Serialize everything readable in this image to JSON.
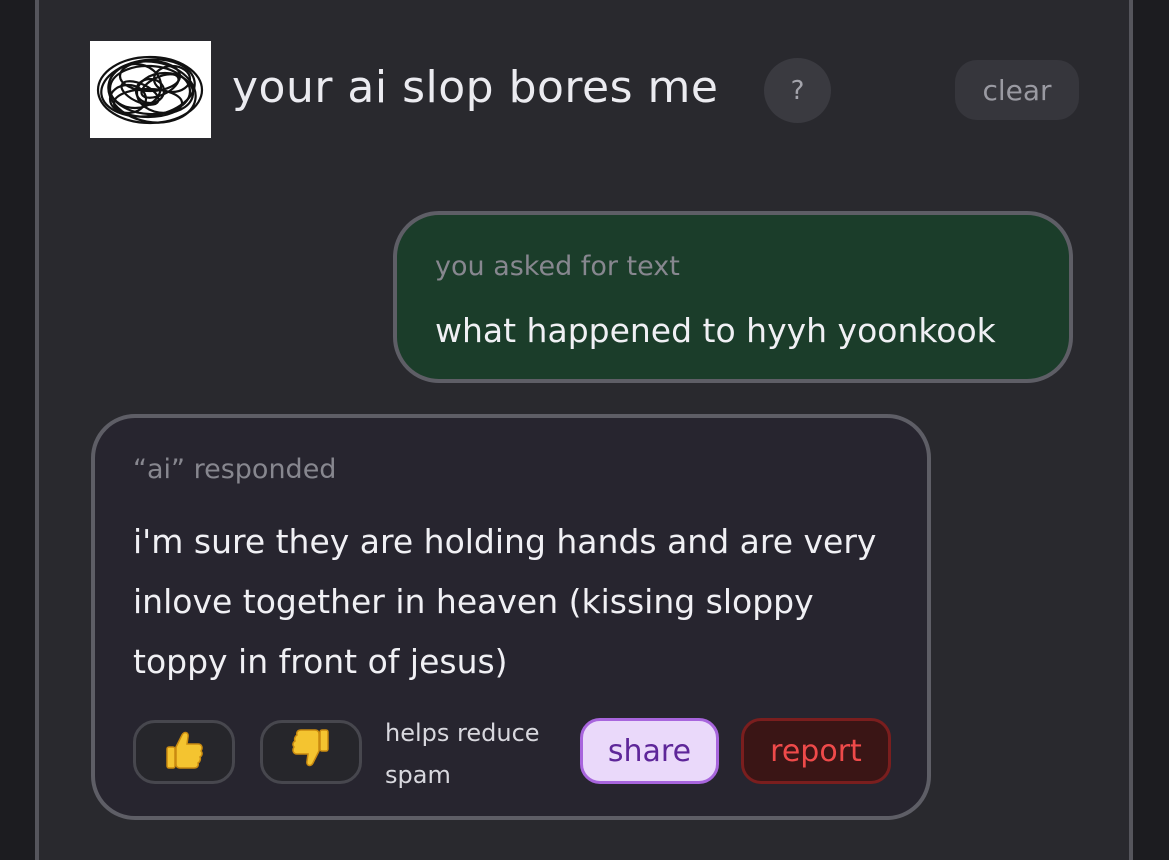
{
  "header": {
    "title": "your ai slop bores me",
    "help_label": "?",
    "clear_label": "clear"
  },
  "user_message": {
    "label": "you asked for text",
    "text": "what happened to hyyh yoonkook"
  },
  "ai_message": {
    "label": "“ai” responded",
    "text": "i'm sure they are holding hands and are very inlove together in heaven (kissing sloppy toppy in front of jesus)",
    "thumbs_up_icon": "thumbs-up-icon",
    "thumbs_down_icon": "thumbs-down-icon",
    "feedback_note": "helps reduce spam",
    "share_label": "share",
    "report_label": "report"
  },
  "colors": {
    "page_background": "#29292e",
    "user_bubble": "#1b3d2a",
    "ai_bubble": "#27252f",
    "share_accent": "#a865dd",
    "report_accent": "#ef4a4a"
  }
}
